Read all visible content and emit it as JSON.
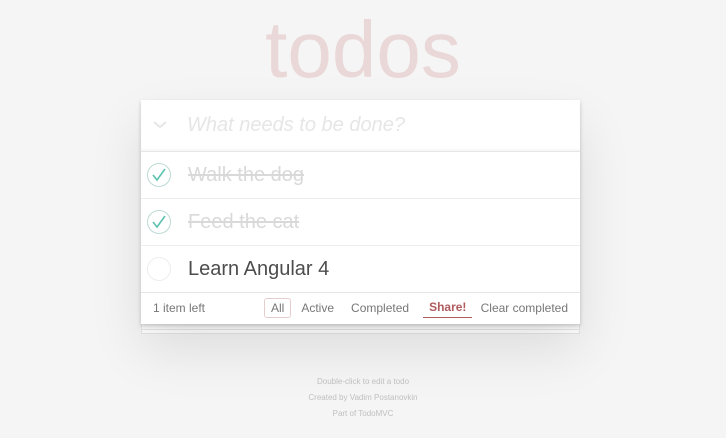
{
  "app": {
    "title": "todos"
  },
  "header": {
    "new_todo_placeholder": "What needs to be done?"
  },
  "todos": [
    {
      "label": "Walk the dog",
      "completed": true
    },
    {
      "label": "Feed the cat",
      "completed": true
    },
    {
      "label": "Learn Angular 4",
      "completed": false
    }
  ],
  "footer": {
    "count_text": "1 item left",
    "filters": [
      {
        "label": "All",
        "selected": true
      },
      {
        "label": "Active",
        "selected": false
      },
      {
        "label": "Completed",
        "selected": false
      }
    ],
    "share_label": "Share!",
    "clear_completed_label": "Clear completed"
  },
  "info": {
    "line1": "Double-click to edit a todo",
    "line2": "Created by Vadim Postanovkin",
    "line3": "Part of TodoMVC"
  },
  "colors": {
    "title": "#ead7d7",
    "check": "#5dc2af",
    "share": "#af5b5e",
    "background": "#f5f5f5"
  }
}
